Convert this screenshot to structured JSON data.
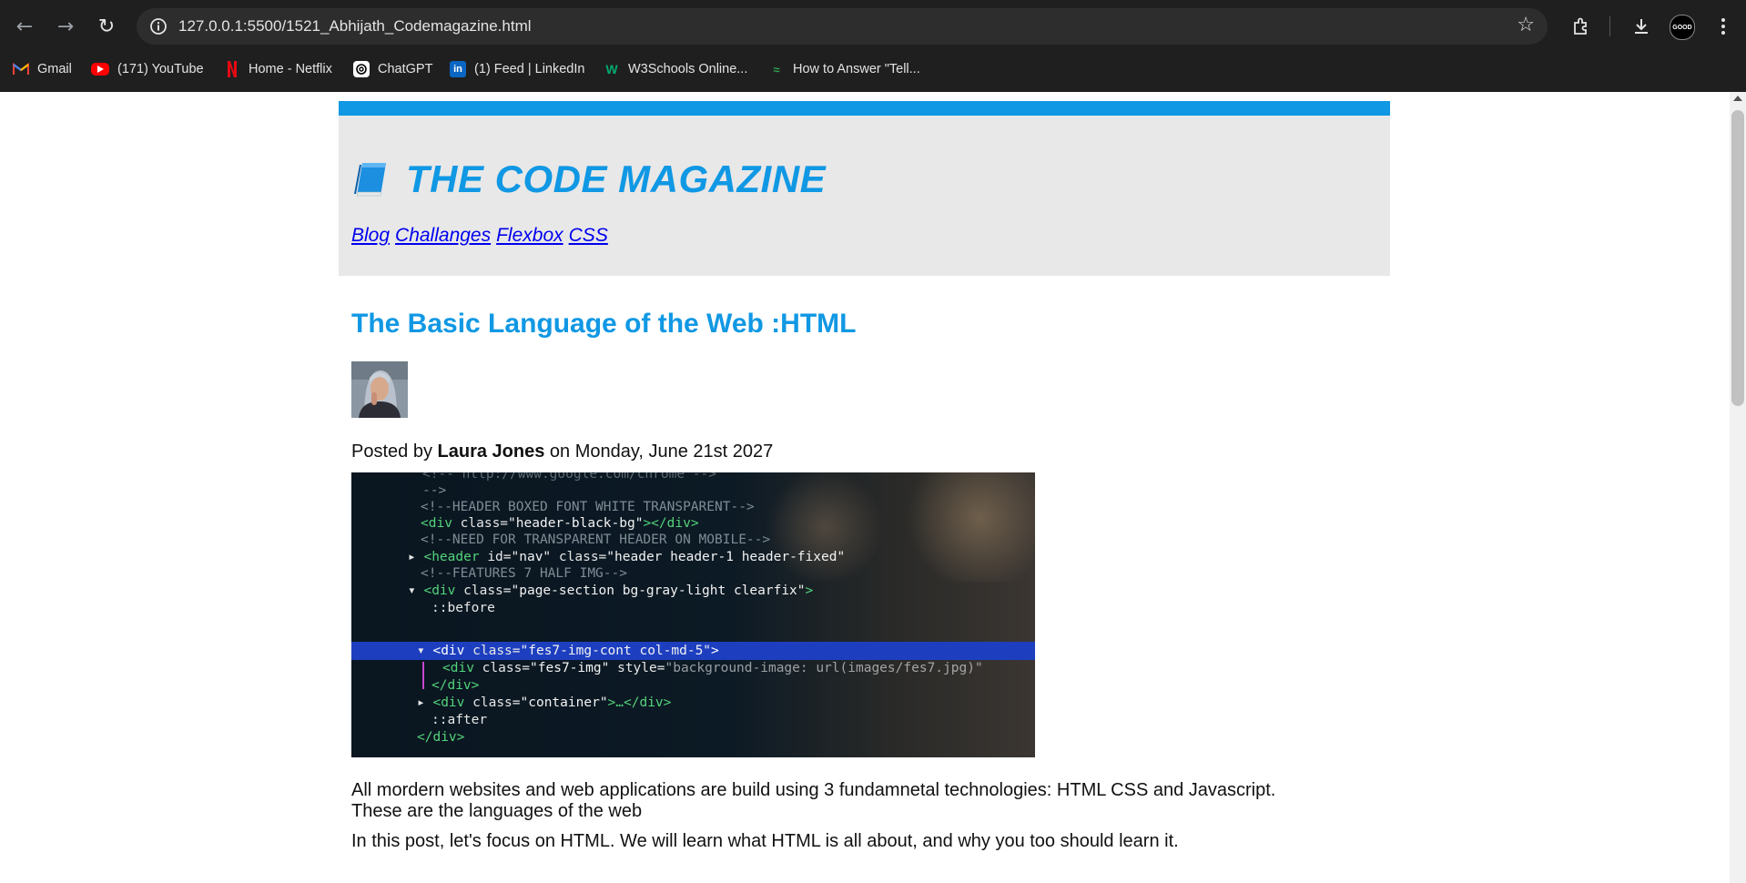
{
  "browser": {
    "url": "127.0.0.1:5500/1521_Abhijath_Codemagazine.html",
    "profile_badge": "GOOD",
    "bookmarks": [
      {
        "label": "Gmail",
        "icon": "gmail-icon"
      },
      {
        "label": "(171) YouTube",
        "icon": "youtube-icon"
      },
      {
        "label": "Home - Netflix",
        "icon": "netflix-icon"
      },
      {
        "label": "ChatGPT",
        "icon": "chatgpt-icon"
      },
      {
        "label": "(1) Feed | LinkedIn",
        "icon": "linkedin-icon"
      },
      {
        "label": "W3Schools Online...",
        "icon": "w3schools-icon"
      },
      {
        "label": "How to Answer \"Tell...",
        "icon": "link-icon"
      }
    ]
  },
  "site": {
    "title": "THE CODE MAGAZINE",
    "accent_color": "#1098e4",
    "nav": [
      "Blog",
      "Challanges",
      "Flexbox",
      "CSS"
    ]
  },
  "post": {
    "title": "The Basic Language of the Web :HTML",
    "byline_prefix": "Posted by",
    "author": "Laura Jones",
    "byline_suffix": "on Monday, June 21st 2027",
    "paragraph1_line1": "All mordern websites and web applications are build using 3 fundamnetal technologies: HTML CSS and Javascript.",
    "paragraph1_line2": "These are the languages of the web",
    "paragraph2": "In this post, let's focus on HTML. We will learn what HTML is all about, and why you too should learn it.",
    "image": {
      "code_lines": [
        "<!--HEADER BOXED FONT WHITE TRANSPARENT-->",
        "<div class=\"header-black-bg\"></div>",
        "<!--NEED FOR TRANSPARENT HEADER ON MOBILE-->",
        "<header id=\"nav\" class=\"header header-1 header-fixed\">",
        "<!--FEATURES 7 HALF IMG-->",
        "<div class=\"page-section bg-gray-light clearfix\">",
        "::before",
        "<div class=\"fes7-img-cont col-md-5\">",
        "<div class=\"fes7-img\" style=\"background-image: url(images/fes7.jpg)\">",
        "</div>",
        "<div class=\"container\"></div>",
        "::after",
        "</div>"
      ]
    }
  }
}
